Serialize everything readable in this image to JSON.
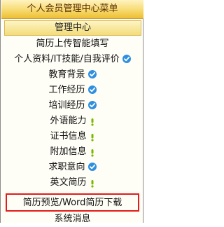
{
  "header": {
    "title": "个人会员管理中心菜单"
  },
  "section": {
    "title": "管理中心"
  },
  "menu": {
    "items": [
      {
        "label": "简历上传智能填写",
        "icon": "none"
      },
      {
        "label": "个人资料/IT技能/自我评价",
        "icon": "check-icon"
      },
      {
        "label": "教育背景",
        "icon": "check-icon"
      },
      {
        "label": "工作经历",
        "icon": "check-icon"
      },
      {
        "label": "培训经历",
        "icon": "check-icon"
      },
      {
        "label": "外语能力",
        "icon": "warning-icon"
      },
      {
        "label": "证书信息",
        "icon": "warning-icon"
      },
      {
        "label": "附加信息",
        "icon": "warning-icon"
      },
      {
        "label": "求职意向",
        "icon": "check-icon"
      },
      {
        "label": "英文简历",
        "icon": "warning-icon"
      },
      {
        "label": "简历预览/Word简历下载",
        "icon": "none",
        "highlighted": true
      },
      {
        "label": "系统消息",
        "icon": "none"
      }
    ]
  },
  "colors": {
    "check": "#2f8fe0",
    "warning": "#7ab800",
    "highlight_border": "#e21b1b",
    "title_bar": "#f6d86a"
  }
}
